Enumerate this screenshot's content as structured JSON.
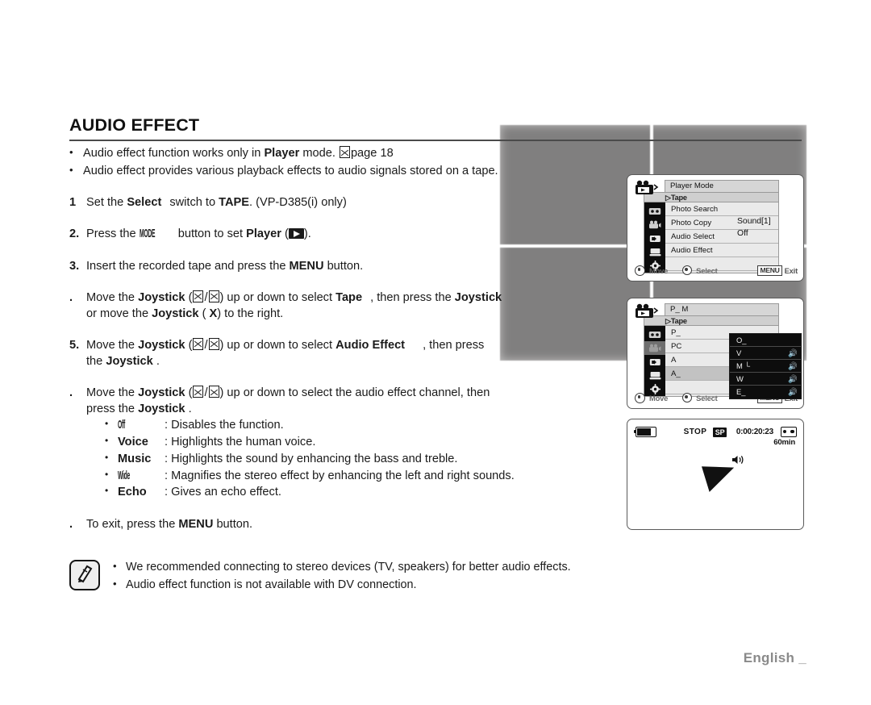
{
  "header": {
    "title": "AUDIO EFFECT"
  },
  "intro_bullets": [
    {
      "pre": "Audio effect function works only in ",
      "bold": "Player",
      "post": " mode. ",
      "ref": "page 18"
    },
    {
      "pre": "Audio effect provides various playback effects to audio signals stored on a tape.",
      "bold": "",
      "post": "",
      "ref": ""
    }
  ],
  "steps": [
    {
      "num": "1",
      "text_parts": [
        "Set the ",
        "Select",
        " switch to ",
        "TAPE",
        ". (VP-D385(i) only)"
      ]
    },
    {
      "num": "2.",
      "text_parts": [
        "Press the ",
        "MODE",
        " button to set ",
        "Player",
        " (",
        ")."
      ]
    },
    {
      "num": "3.",
      "text_parts": [
        "Insert the recorded tape and press the ",
        "MENU",
        " button."
      ]
    },
    {
      "num": ".",
      "text_parts": [
        "Move the ",
        "Joystick",
        " (",
        "/",
        ") up or down to select ",
        "Tape",
        ", then press the ",
        "Joystick",
        " or move the ",
        "Joystick",
        " (",
        ") to the right."
      ]
    },
    {
      "num": "5.",
      "text_parts": [
        "Move the ",
        "Joystick",
        " (",
        "/",
        ") up or down to select ",
        "Audio Effect",
        ", then press the ",
        "Joystick",
        "."
      ]
    },
    {
      "num": ".",
      "text_parts": [
        "Move the ",
        "Joystick",
        " (",
        "/",
        ") up or down to select the audio effect channel, then press the ",
        "Joystick",
        "."
      ]
    },
    {
      "num": ".",
      "text_parts": [
        "To exit, press the ",
        "MENU",
        " button."
      ]
    }
  ],
  "step_labels": {
    "set_the": "Set the",
    "select": "Select",
    "switch_to": "switch to",
    "tape_caps": "TAPE",
    "vp_model": ". (VP-D385(i) only)",
    "press_the": "Press the",
    "mode_btn": "MODE",
    "button_to_set": "button to set",
    "player": "Player",
    "paren_close": ").",
    "insert_tape": "Insert the recorded tape and press the",
    "menu_btn": "MENU",
    "button_period": "button.",
    "move_the": "Move the",
    "joystick": "Joystick",
    "updown_select": "up or down to select",
    "tape": "Tape",
    "then_press_the": ", then press the",
    "or_move_the": "or move the",
    "to_the_right": ") to the right.",
    "audio_effect": "Audio Effect",
    "then_press": ", then press",
    "the_word": "the",
    "period": ".",
    "select_channel": "up or down to select the audio effect channel, then",
    "press_the2": "press the",
    "to_exit": "To exit, press the"
  },
  "effect_channels": [
    {
      "name": "Off",
      "desc": ": Disables the function."
    },
    {
      "name": "Voice",
      "desc": ": Highlights the human voice."
    },
    {
      "name": "Music",
      "desc": ": Highlights the sound by enhancing the bass and treble."
    },
    {
      "name": "Wide",
      "desc": ": Magnifies the stereo effect by enhancing the left and right sounds."
    },
    {
      "name": "Echo",
      "desc": ": Gives an echo effect."
    }
  ],
  "note": {
    "icon": "note-pen-icon",
    "items": [
      "We recommended connecting to stereo devices (TV, speakers) for better audio effects.",
      "Audio effect function is not available with DV connection."
    ]
  },
  "footer": {
    "language": "English _"
  },
  "lcd1": {
    "title": "Player Mode",
    "sub": "Tape",
    "sub_marker": "▷",
    "items": [
      {
        "label": "Photo Search",
        "selected": false
      },
      {
        "label": "Photo Copy",
        "selected": false
      },
      {
        "label": "Audio Select",
        "selected": false
      },
      {
        "label": "Audio Effect",
        "selected": false
      },
      {
        "label": "",
        "selected": false
      }
    ],
    "values": [
      "Sound[1]",
      "Off"
    ],
    "foot": {
      "move": "Move",
      "select": "Select",
      "menu_key": "MENU",
      "exit": "Exit"
    }
  },
  "lcd2": {
    "title": "P_        M",
    "sub": "Tape",
    "sub_marker": "▷",
    "items": [
      {
        "label": "P_",
        "selected": false
      },
      {
        "label": "PC",
        "selected": false
      },
      {
        "label": "A",
        "selected": false
      },
      {
        "label": "A_",
        "selected": true
      },
      {
        "label": "",
        "selected": false
      }
    ],
    "submenu": [
      {
        "label": "O_",
        "icon": "",
        "selected": false
      },
      {
        "label": "V",
        "icon": "🔊",
        "selected": false
      },
      {
        "label": "M    └",
        "icon": "🔊",
        "selected": false
      },
      {
        "label": "W",
        "icon": "🔊",
        "selected": false
      },
      {
        "label": "E_",
        "icon": "🔊",
        "selected": false
      }
    ],
    "foot": {
      "move": "Move",
      "select": "Select",
      "menu_key": "MENU",
      "exit": "Exit"
    }
  },
  "lcd3": {
    "battery": "battery-icon",
    "status": "STOP",
    "speed": "SP",
    "timecode": "0:00:20:23",
    "tape": "tape-icon",
    "remaining": "60min",
    "audio_icon": "speaker-icon"
  }
}
